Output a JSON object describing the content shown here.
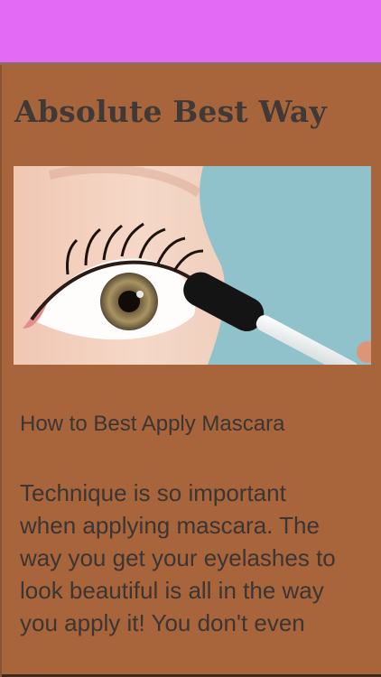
{
  "article": {
    "title": "Absolute Best Way",
    "subtitle": "How to Best Apply Mascara",
    "body_lines": [
      "Technique is so important",
      "when applying mascara. The",
      "way you get your eyelashes to",
      "look beautiful is all in the way",
      "you apply it! You don't even"
    ]
  },
  "colors": {
    "topbar": "#e36af5",
    "background": "#a8643a",
    "text": "#3b3533"
  }
}
